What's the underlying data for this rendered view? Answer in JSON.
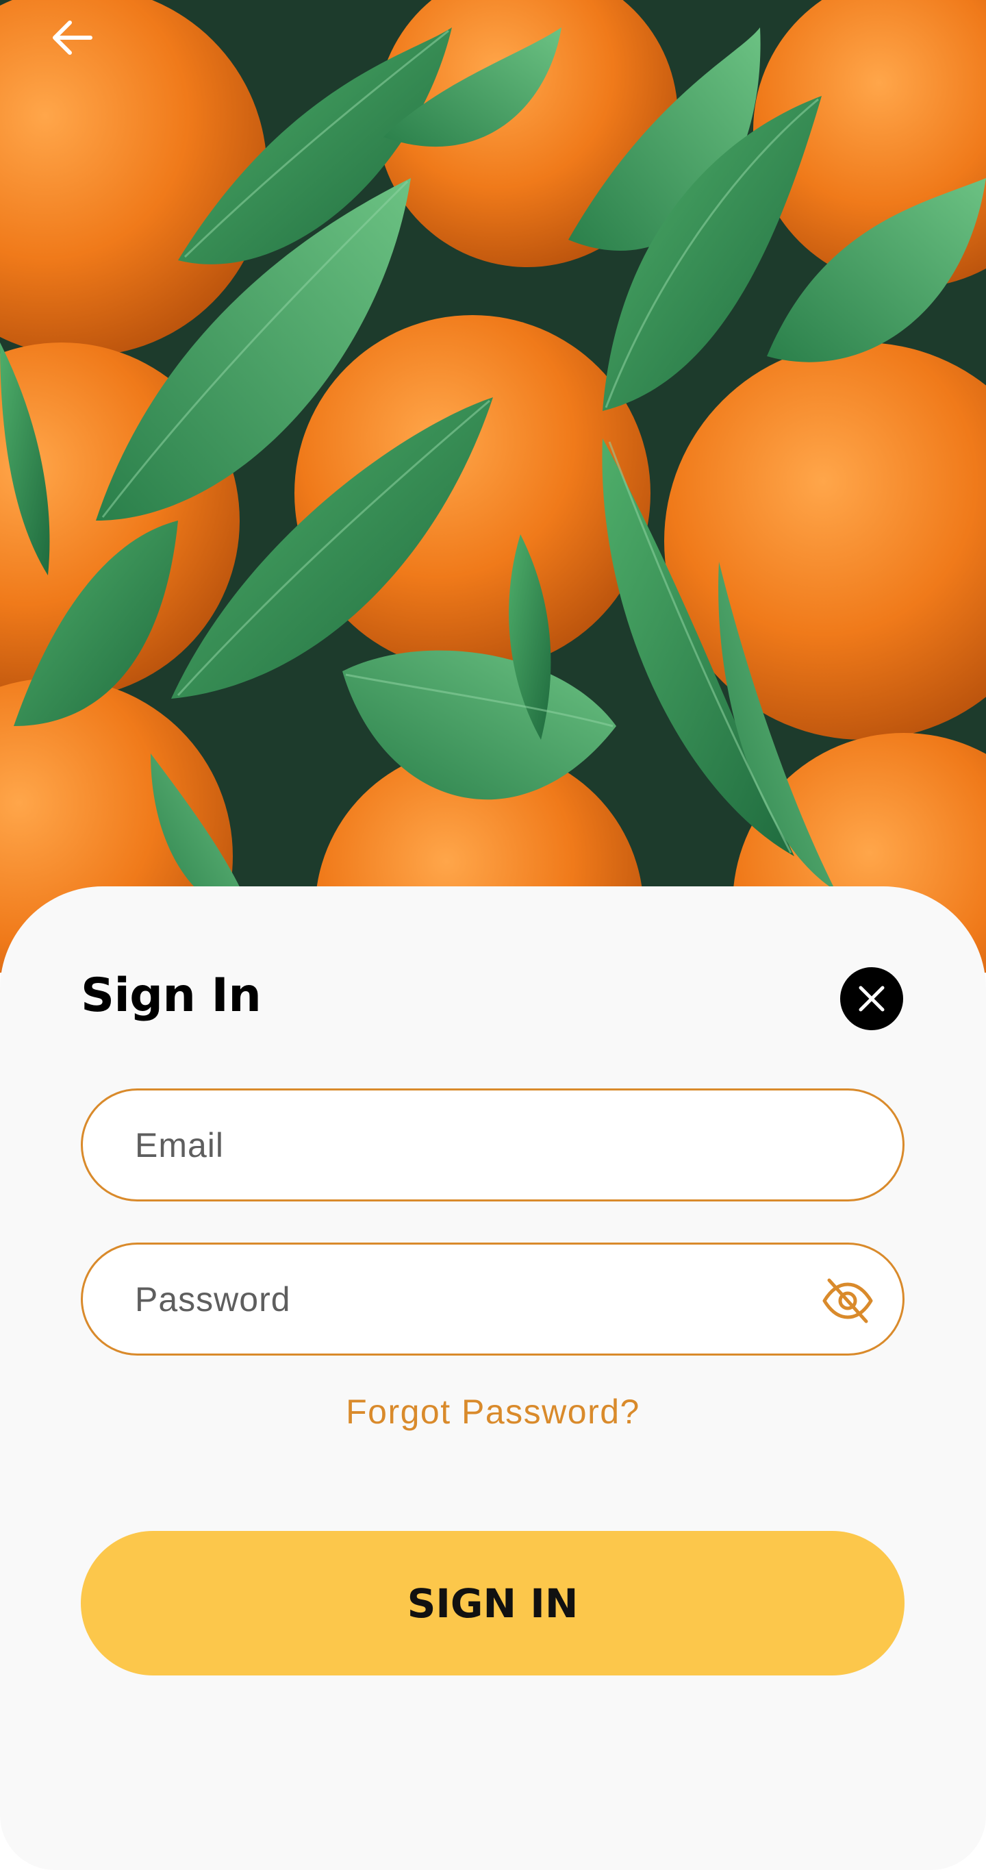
{
  "header": {
    "back_icon": "arrow-left-icon"
  },
  "hero": {
    "image_subject": "oranges-with-leaves",
    "colors": {
      "orange": "#f07a1a",
      "leaf": "#3f9a5a",
      "leaf_dark": "#1f6b3e",
      "shadow": "#1d3b2c"
    }
  },
  "sheet": {
    "title": "Sign In",
    "close_icon": "close-icon",
    "email": {
      "placeholder": "Email",
      "value": ""
    },
    "password": {
      "placeholder": "Password",
      "value": "",
      "toggle_icon": "eye-off-icon"
    },
    "forgot_label": "Forgot Password?",
    "submit_label": "SIGN IN",
    "colors": {
      "accent": "#d98a2b",
      "button": "#fcc74b",
      "sheet_bg": "#f9f9f9",
      "close_bg": "#000000"
    }
  }
}
